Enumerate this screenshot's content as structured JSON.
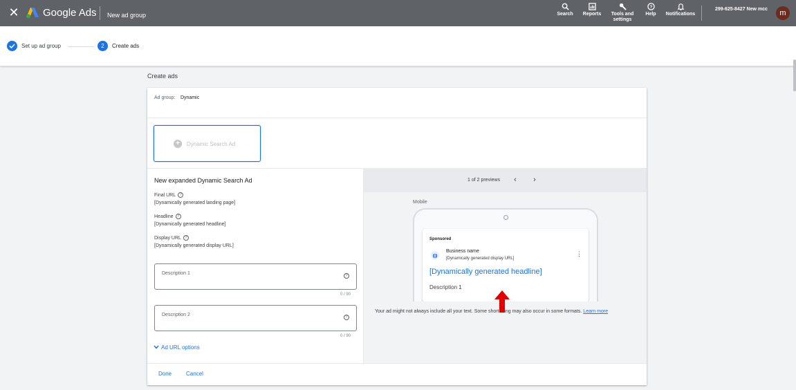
{
  "header": {
    "close_glyph": "✕",
    "brand": "Google Ads",
    "page_title": "New ad group",
    "tools": {
      "search": "Search",
      "reports": "Reports",
      "tools_line1": "Tools and",
      "tools_line2": "settings",
      "help": "Help",
      "notifications": "Notifications"
    },
    "account": "299-625-8427 New mcc",
    "avatar_letter": "m",
    "colors": {
      "bar": "#5f6368",
      "avatar": "#6d2b1f"
    }
  },
  "stepper": {
    "step1_label": "Set up ad group",
    "step2_number": "2",
    "step2_label": "Create ads"
  },
  "section_title": "Create ads",
  "ad_group": {
    "label": "Ad group:",
    "value": "Dynamic"
  },
  "ad_type_tile": {
    "label": "Dynamic Search Ad",
    "icon": "plus-circle-icon"
  },
  "form": {
    "title": "New expanded Dynamic Search Ad",
    "final_url": {
      "label": "Final URL",
      "value": "[Dynamically generated landing page]"
    },
    "headline": {
      "label": "Headline",
      "value": "[Dynamically generated headline]"
    },
    "display_url": {
      "label": "Display URL",
      "value": "[Dynamically generated display URL]"
    },
    "description1": {
      "placeholder": "Description 1",
      "counter": "0 / 90"
    },
    "description2": {
      "placeholder": "Description 2",
      "counter": "0 / 90"
    },
    "url_options": "Ad URL options",
    "help_glyph": "?"
  },
  "actions": {
    "done": "Done",
    "cancel": "Cancel"
  },
  "preview": {
    "count": "1 of 2 previews",
    "prev_glyph": "‹",
    "next_glyph": "›",
    "device_label": "Mobile",
    "ad": {
      "sponsored": "Sponsored",
      "business_name": "Business name",
      "display_url": "[Dynamically generated display URL]",
      "headline": "[Dynamically generated headline]",
      "description": "Description 1",
      "menu_glyph": "⋮"
    },
    "note": "Your ad might not always include all your text. Some shortening may also occur in some formats.",
    "learn_more": "Learn more"
  },
  "colors": {
    "accent": "#1a73e8",
    "annotation_arrow": "#e00000"
  }
}
